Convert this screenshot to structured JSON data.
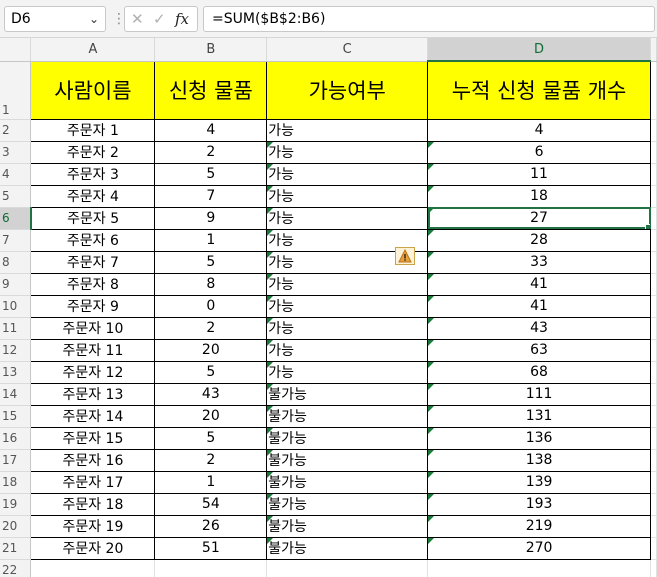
{
  "formula_bar": {
    "cell_ref": "D6",
    "formula": "=SUM($B$2:B6)",
    "fx_label": "fx",
    "cancel_icon": "close-icon",
    "enter_icon": "check-icon"
  },
  "columns": [
    "A",
    "B",
    "C",
    "D"
  ],
  "selected_column": "D",
  "selected_row": "6",
  "header_row": {
    "row_number": "1",
    "cells": [
      "사람이름",
      "신청 물품",
      "가능여부",
      "누적 신청 물품 개수"
    ]
  },
  "rows": [
    {
      "num": "2",
      "name": "주문자 1",
      "qty": "4",
      "status": "가능",
      "cumulative": "4"
    },
    {
      "num": "3",
      "name": "주문자 2",
      "qty": "2",
      "status": "가능",
      "cumulative": "6"
    },
    {
      "num": "4",
      "name": "주문자 3",
      "qty": "5",
      "status": "가능",
      "cumulative": "11"
    },
    {
      "num": "5",
      "name": "주문자 4",
      "qty": "7",
      "status": "가능",
      "cumulative": "18"
    },
    {
      "num": "6",
      "name": "주문자 5",
      "qty": "9",
      "status": "가능",
      "cumulative": "27"
    },
    {
      "num": "7",
      "name": "주문자 6",
      "qty": "1",
      "status": "가능",
      "cumulative": "28"
    },
    {
      "num": "8",
      "name": "주문자 7",
      "qty": "5",
      "status": "가능",
      "cumulative": "33"
    },
    {
      "num": "9",
      "name": "주문자 8",
      "qty": "8",
      "status": "가능",
      "cumulative": "41"
    },
    {
      "num": "10",
      "name": "주문자 9",
      "qty": "0",
      "status": "가능",
      "cumulative": "41"
    },
    {
      "num": "11",
      "name": "주문자 10",
      "qty": "2",
      "status": "가능",
      "cumulative": "43"
    },
    {
      "num": "12",
      "name": "주문자 11",
      "qty": "20",
      "status": "가능",
      "cumulative": "63"
    },
    {
      "num": "13",
      "name": "주문자 12",
      "qty": "5",
      "status": "가능",
      "cumulative": "68"
    },
    {
      "num": "14",
      "name": "주문자 13",
      "qty": "43",
      "status": "불가능",
      "cumulative": "111"
    },
    {
      "num": "15",
      "name": "주문자 14",
      "qty": "20",
      "status": "불가능",
      "cumulative": "131"
    },
    {
      "num": "16",
      "name": "주문자 15",
      "qty": "5",
      "status": "불가능",
      "cumulative": "136"
    },
    {
      "num": "17",
      "name": "주문자 16",
      "qty": "2",
      "status": "불가능",
      "cumulative": "138"
    },
    {
      "num": "18",
      "name": "주문자 17",
      "qty": "1",
      "status": "불가능",
      "cumulative": "139"
    },
    {
      "num": "19",
      "name": "주문자 18",
      "qty": "54",
      "status": "불가능",
      "cumulative": "193"
    },
    {
      "num": "20",
      "name": "주문자 19",
      "qty": "26",
      "status": "불가능",
      "cumulative": "219"
    },
    {
      "num": "21",
      "name": "주문자 20",
      "qty": "51",
      "status": "불가능",
      "cumulative": "270"
    }
  ],
  "empty_row_number": "22",
  "error_indicator_icon": "warning-icon",
  "colors": {
    "header_fill": "#ffff00",
    "accent": "#217346",
    "error_triangle": "#1a7a3a"
  }
}
